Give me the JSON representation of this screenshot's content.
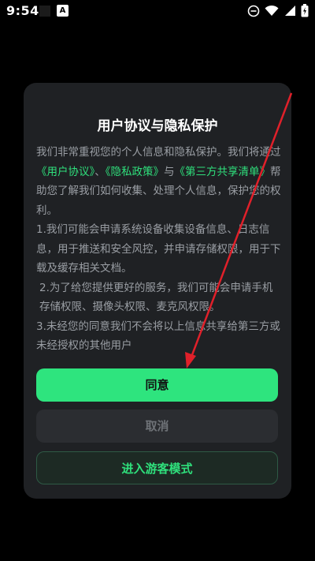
{
  "status_bar": {
    "time": "9:54",
    "notif_icon_label": "A"
  },
  "dialog": {
    "title": "用户协议与隐私保护",
    "intro_1": "我们非常重视您的个人信息和隐私保护。我们将通过",
    "link_user_agreement": "《用户协议》",
    "sep_1": "、",
    "link_privacy_policy": "《隐私政策》",
    "sep_2": "与",
    "link_third_party": "《第三方共享清单》",
    "intro_2": "帮助您了解我们如何收集、处理个人信息，保护您的权利。",
    "item_1": "1.我们可能会申请系统设备收集设备信息、日志信息，用于推送和安全风控，并申请存储权限，用于下载及缓存相关文档。",
    "item_2": "2.为了给您提供更好的服务，我们可能会申请手机存储权限、摄像头权限、麦克风权限。",
    "item_3": "3.未经您的同意我们不会将以上信息共享给第三方或未经授权的其他用户",
    "agree_label": "同意",
    "cancel_label": "取消",
    "guest_label": "进入游客模式"
  },
  "colors": {
    "accent": "#2ee47e",
    "dialog_bg": "#1f2124",
    "arrow": "#e0202a"
  }
}
